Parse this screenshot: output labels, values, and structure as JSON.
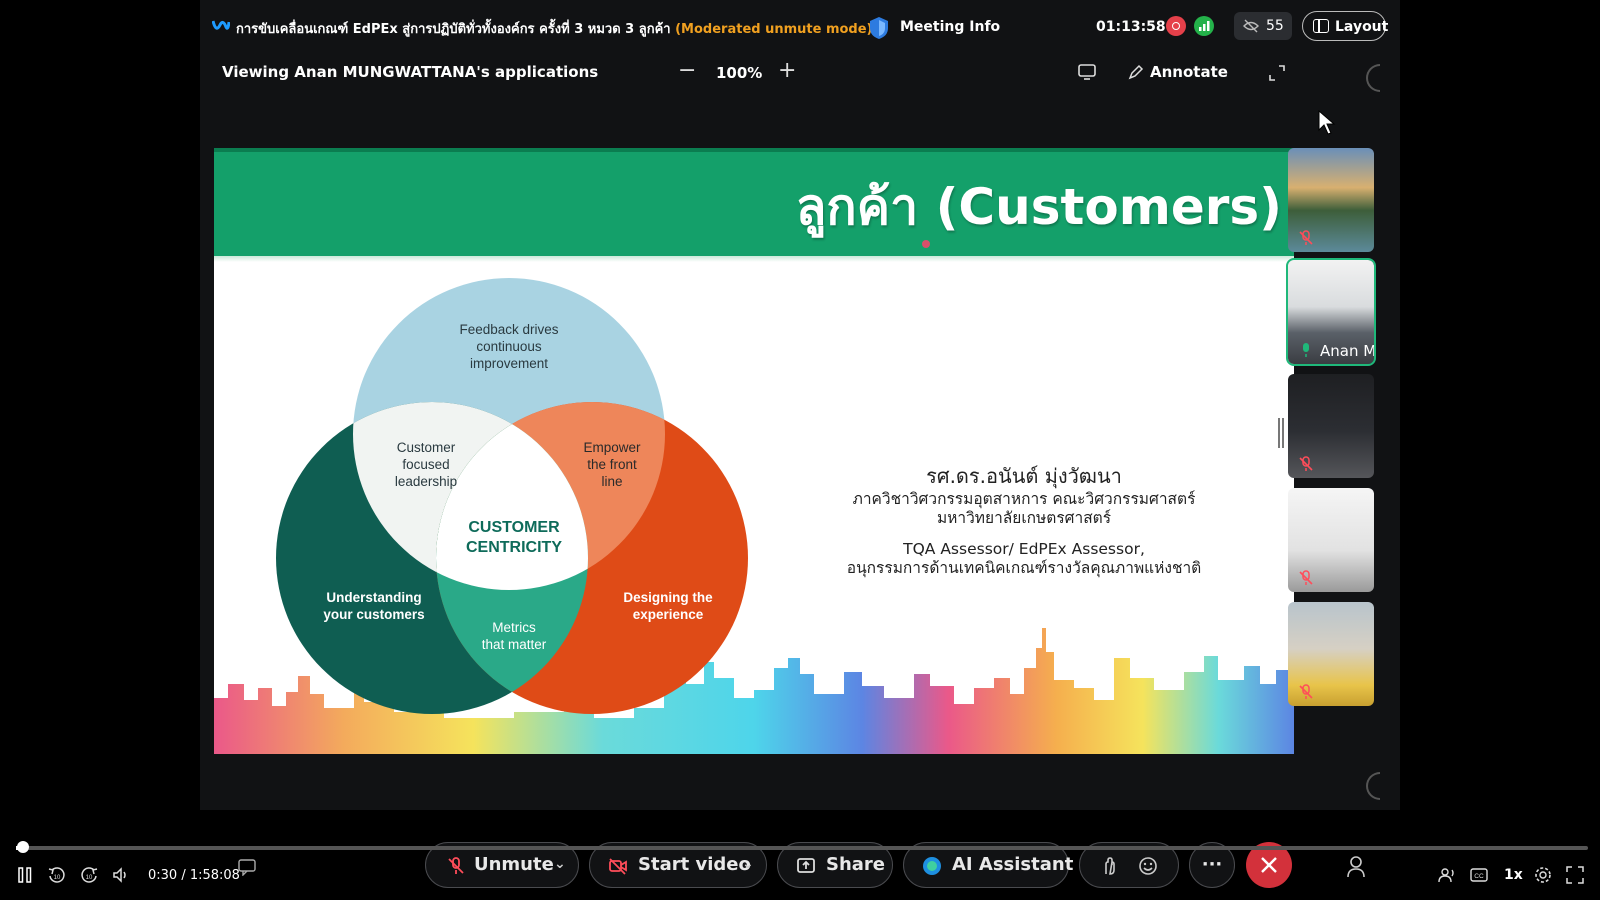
{
  "meeting": {
    "title": "การขับเคลื่อนเกณฑ์ EdPEx สู่การปฏิบัติทั่วทั้งองค์กร ครั้งที่ 3 หมวด 3 ลูกค้า",
    "mode": "(Moderated unmute mode)",
    "info_label": "Meeting Info",
    "timer": "01:13:58",
    "participant_count": "55",
    "layout_label": "Layout",
    "viewing_label": "Viewing Anan MUNGWATTANA's applications",
    "zoom_minus": "−",
    "zoom_level": "100%",
    "zoom_plus": "+",
    "annotate_label": "Annotate",
    "colors": {
      "accent": "#1fb87a",
      "mode": "#f0a020",
      "end": "#d3313b",
      "record": "#e5404a"
    }
  },
  "slide": {
    "title": "ลูกค้า (Customers)",
    "venn": {
      "top": "Feedback drives\ncontinuous\nimprovement",
      "left": "Understanding\nyour customers",
      "right": "Designing the\nexperience",
      "top_left": "Customer\nfocused\nleadership",
      "top_right": "Empower\nthe front\nline",
      "bottom": "Metrics\nthat matter",
      "center": "CUSTOMER\nCENTRICITY",
      "colors": {
        "top": "#a9d3e2",
        "left": "#0f5e52",
        "right": "#df4b17",
        "top_left": "#f1f4f2",
        "top_right": "#ee865a",
        "bottom": "#2aa988",
        "center": "#ffffff",
        "center_text": "#0e6b5a"
      }
    },
    "speaker": {
      "name": "รศ.ดร.อนันต์ มุ่งวัฒนา",
      "line1": "ภาควิชาวิศวกรรมอุตสาหการ คณะวิศวกรรมศาสตร์",
      "line2": "มหาวิทยาลัยเกษตรศาสตร์",
      "line3": "TQA Assessor/ EdPEx Assessor,",
      "line4": "อนุกรรมการด้านเทคนิคเกณฑ์รางวัลคุณภาพแห่งชาติ"
    }
  },
  "participants": [
    {
      "name": "",
      "icon": "mic-muted-icon"
    },
    {
      "name": "Anan M",
      "icon": "mic-active-icon",
      "active": true
    },
    {
      "name": "",
      "icon": "mic-muted-icon"
    },
    {
      "name": "",
      "icon": "mic-muted-icon"
    },
    {
      "name": "",
      "icon": "mic-muted-icon"
    }
  ],
  "controls": {
    "unmute": "Unmute",
    "start_video": "Start video",
    "share": "Share",
    "ai_assistant": "AI Assistant",
    "more": "···"
  },
  "player": {
    "current_time": "0:30",
    "duration": "1:58:08",
    "time_text": "0:30 / 1:58:08",
    "progress_fraction": 0.0042,
    "speed": "1x",
    "rewind": "10",
    "forward": "10"
  }
}
